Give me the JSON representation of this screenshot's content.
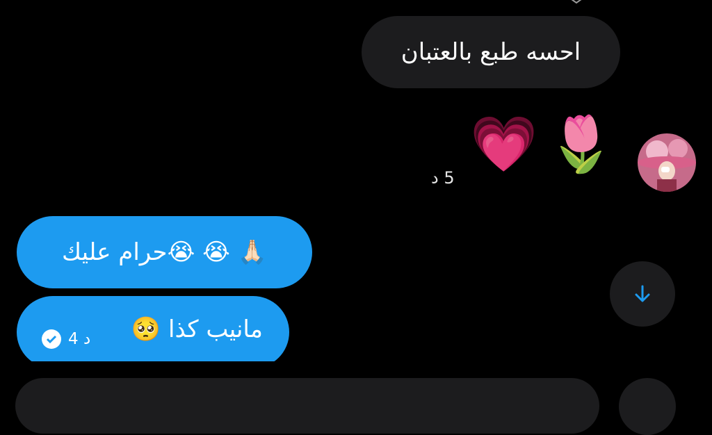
{
  "conversation": {
    "received_text": "احسه طبع بالعتبان",
    "received_emojis": [
      "💗",
      "🌷"
    ],
    "received_time": "5 د",
    "sent_messages": [
      {
        "text": "🙏🏻 😭 😭حرام عليك"
      },
      {
        "text": "مانيب كذا 🥺",
        "time": "4 د"
      }
    ]
  },
  "colors": {
    "background": "#000000",
    "received_bubble": "#1c1c1e",
    "sent_bubble": "#1d9bf0",
    "accent": "#1d9bf0"
  },
  "icons": {
    "scroll_down": "arrow-down-icon",
    "read_receipt": "check-circle-icon"
  }
}
